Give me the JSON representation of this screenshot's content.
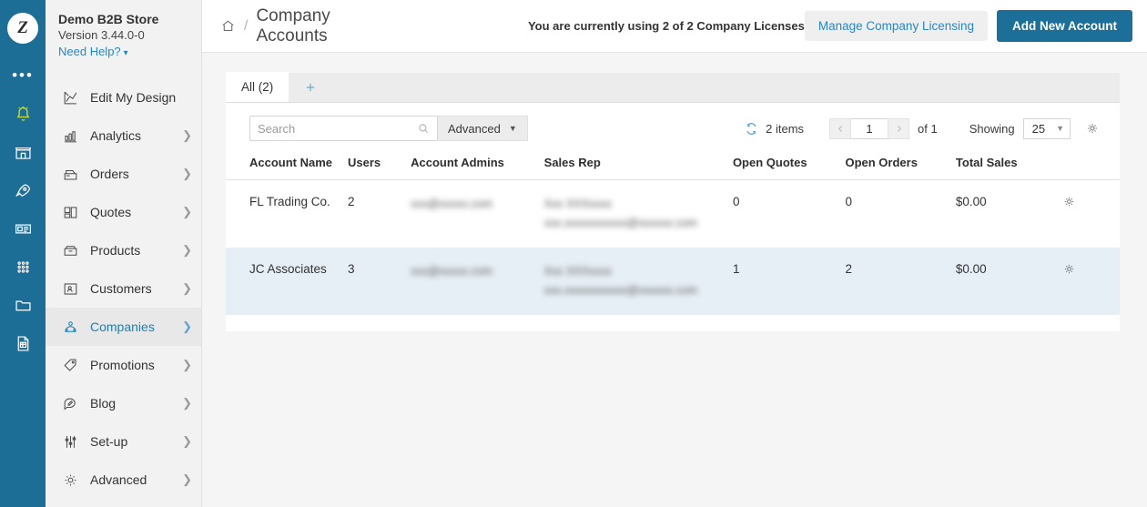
{
  "brand": {
    "logo_letter": "Z",
    "store_name": "Demo B2B Store",
    "version": "Version 3.44.0-0",
    "help_label": "Need Help?"
  },
  "rail": {
    "icons": [
      "more-dots",
      "bell-icon",
      "storefront-icon",
      "rocket-icon",
      "article-icon",
      "apps-grid-icon",
      "folder-icon",
      "document-icon"
    ]
  },
  "sidebar": {
    "items": [
      {
        "label": "Edit My Design",
        "icon": "design-icon",
        "has_arrow": false,
        "active": false
      },
      {
        "label": "Analytics",
        "icon": "analytics-icon",
        "has_arrow": true,
        "active": false
      },
      {
        "label": "Orders",
        "icon": "orders-icon",
        "has_arrow": true,
        "active": false
      },
      {
        "label": "Quotes",
        "icon": "quotes-icon",
        "has_arrow": true,
        "active": false
      },
      {
        "label": "Products",
        "icon": "products-icon",
        "has_arrow": true,
        "active": false
      },
      {
        "label": "Customers",
        "icon": "customers-icon",
        "has_arrow": true,
        "active": false
      },
      {
        "label": "Companies",
        "icon": "companies-icon",
        "has_arrow": true,
        "active": true
      },
      {
        "label": "Promotions",
        "icon": "promotions-icon",
        "has_arrow": true,
        "active": false
      },
      {
        "label": "Blog",
        "icon": "blog-icon",
        "has_arrow": true,
        "active": false
      },
      {
        "label": "Set-up",
        "icon": "setup-icon",
        "has_arrow": true,
        "active": false
      },
      {
        "label": "Advanced",
        "icon": "advanced-gear-icon",
        "has_arrow": true,
        "active": false
      }
    ]
  },
  "header": {
    "home_icon": "home-icon",
    "separator": "/",
    "page_title": "Company Accounts",
    "license_note": "You are currently using 2 of 2 Company Licenses",
    "manage_button": "Manage Company Licensing",
    "add_button": "Add New Account"
  },
  "tabs": {
    "items": [
      {
        "label": "All (2)",
        "active": true
      }
    ],
    "add_tab_icon": "plus-icon"
  },
  "toolbar": {
    "search_placeholder": "Search",
    "search_value": "",
    "search_icon": "search-icon",
    "advanced_label": "Advanced",
    "refresh_icon": "refresh-icon",
    "items_count": "2 items",
    "prev_icon": "chevron-left-icon",
    "next_icon": "chevron-right-icon",
    "page_value": "1",
    "page_of": "of 1",
    "showing_label": "Showing",
    "showing_value": "25",
    "settings_icon": "gear-icon"
  },
  "table": {
    "columns": [
      "Account Name",
      "Users",
      "Account Admins",
      "Sales Rep",
      "Open Quotes",
      "Open Orders",
      "Total Sales"
    ],
    "rows": [
      {
        "account_name": "FL Trading Co.",
        "users": "2",
        "account_admins": "xxx@xxxxx.com",
        "sales_rep_name": "Xxx XXXxxxx",
        "sales_rep_email": "xxx.xxxxxxxxxxx@xxxxxx.com",
        "open_quotes": "0",
        "open_orders": "0",
        "total_sales": "$0.00",
        "action_icon": "gear-icon",
        "highlighted": false
      },
      {
        "account_name": "JC Associates",
        "users": "3",
        "account_admins": "xxx@xxxxx.com",
        "sales_rep_name": "Xxx XXXxxxx",
        "sales_rep_email": "xxx.xxxxxxxxxxx@xxxxxx.com",
        "open_quotes": "1",
        "open_orders": "2",
        "total_sales": "$0.00",
        "action_icon": "gear-icon",
        "highlighted": true
      }
    ]
  },
  "colors": {
    "rail_blue": "#1c6e96",
    "primary_button": "#1b6f98",
    "link_blue": "#2b86c5",
    "row_highlight": "#e7eff6",
    "bell_yellow": "#c8d92a"
  }
}
